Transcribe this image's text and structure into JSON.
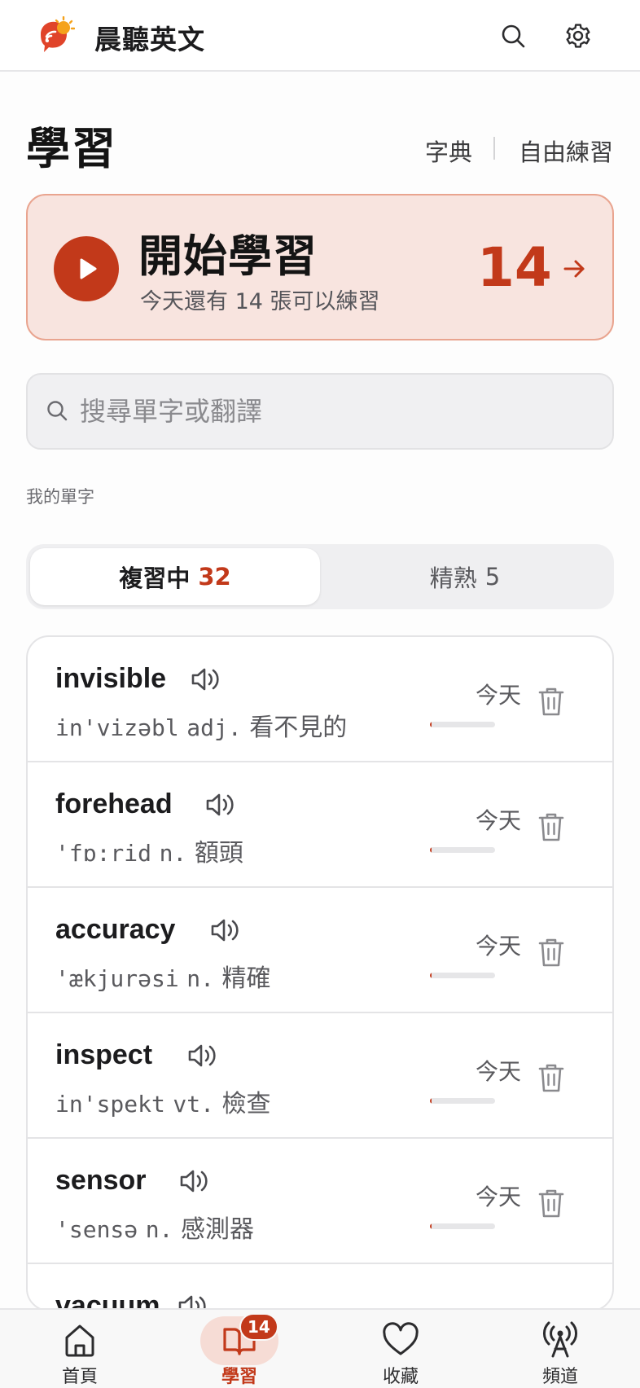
{
  "app": {
    "title": "晨聽英文"
  },
  "header": {
    "search_icon": "search-icon",
    "settings_icon": "gear-icon"
  },
  "page": {
    "title": "學習",
    "link_dictionary": "字典",
    "link_free_practice": "自由練習"
  },
  "start_card": {
    "title": "開始學習",
    "subtitle": "今天還有 14 張可以練習",
    "count": "14",
    "accent": "#c2391a"
  },
  "search": {
    "placeholder": "搜尋單字或翻譯"
  },
  "section": {
    "label": "我的單字"
  },
  "tabs": [
    {
      "label": "複習中",
      "count": "32",
      "active": true
    },
    {
      "label": "精熟",
      "count": "5",
      "active": false
    }
  ],
  "words": [
    {
      "word": "invisible",
      "ipa": "in'vizəbl",
      "pos": "adj.",
      "meaning": "看不見的",
      "due": "今天",
      "progress": 0.03
    },
    {
      "word": "forehead",
      "ipa": "'fɒ:rid",
      "pos": "n.",
      "meaning": "額頭",
      "due": "今天",
      "progress": 0.03
    },
    {
      "word": "accuracy",
      "ipa": "'ækjurəsi",
      "pos": "n.",
      "meaning": "精確",
      "due": "今天",
      "progress": 0.03
    },
    {
      "word": "inspect",
      "ipa": "in'spekt",
      "pos": "vt.",
      "meaning": "檢查",
      "due": "今天",
      "progress": 0.03
    },
    {
      "word": "sensor",
      "ipa": "'sensə",
      "pos": "n.",
      "meaning": "感測器",
      "due": "今天",
      "progress": 0.03
    },
    {
      "word": "vacuum",
      "ipa": "",
      "pos": "",
      "meaning": "",
      "due": "",
      "progress": 0
    }
  ],
  "bottom_nav": {
    "items": [
      {
        "label": "首頁",
        "icon": "home-icon"
      },
      {
        "label": "學習",
        "icon": "book-icon",
        "active": true,
        "badge": "14"
      },
      {
        "label": "收藏",
        "icon": "heart-icon"
      },
      {
        "label": "頻道",
        "icon": "broadcast-icon"
      }
    ]
  }
}
